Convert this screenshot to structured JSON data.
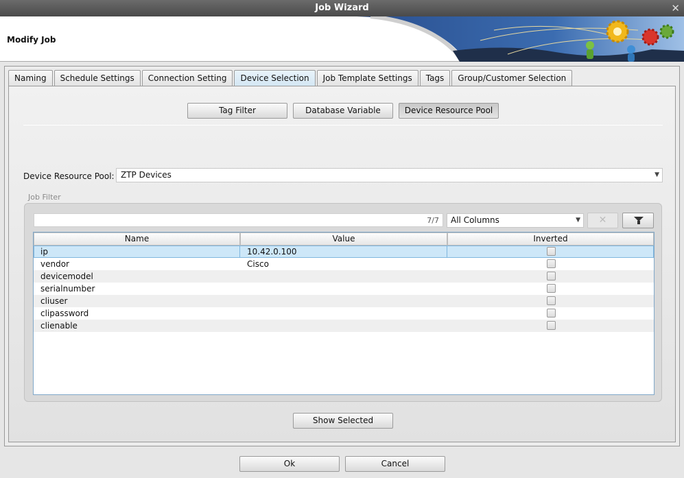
{
  "window": {
    "title": "Job Wizard",
    "subtitle": "Modify Job"
  },
  "tabs": [
    {
      "label": "Naming",
      "active": false
    },
    {
      "label": "Schedule Settings",
      "active": false
    },
    {
      "label": "Connection Setting",
      "active": false
    },
    {
      "label": "Device Selection",
      "active": true
    },
    {
      "label": "Job Template Settings",
      "active": false
    },
    {
      "label": "Tags",
      "active": false
    },
    {
      "label": "Group/Customer Selection",
      "active": false
    }
  ],
  "selection_modes": {
    "tag_filter": "Tag Filter",
    "database_variable": "Database Variable",
    "device_resource_pool": "Device Resource Pool",
    "active": "device_resource_pool"
  },
  "pool": {
    "label": "Device Resource Pool:",
    "value": "ZTP Devices"
  },
  "job_filter": {
    "label": "Job Filter",
    "search_count": "7/7",
    "columns_select": "All Columns",
    "clear_glyph": "✕",
    "columns": [
      "Name",
      "Value",
      "Inverted"
    ],
    "rows": [
      {
        "name": "ip",
        "value": "10.42.0.100",
        "inverted": false,
        "selected": true
      },
      {
        "name": "vendor",
        "value": "Cisco",
        "inverted": false,
        "selected": false
      },
      {
        "name": "devicemodel",
        "value": "",
        "inverted": false,
        "selected": false
      },
      {
        "name": "serialnumber",
        "value": "",
        "inverted": false,
        "selected": false
      },
      {
        "name": "cliuser",
        "value": "",
        "inverted": false,
        "selected": false
      },
      {
        "name": "clipassword",
        "value": "",
        "inverted": false,
        "selected": false
      },
      {
        "name": "clienable",
        "value": "",
        "inverted": false,
        "selected": false
      }
    ]
  },
  "buttons": {
    "show_selected": "Show Selected",
    "ok": "Ok",
    "cancel": "Cancel"
  },
  "icons": {
    "close": "close-icon",
    "filter": "funnel-icon",
    "dropdown": "chevron-down-icon"
  }
}
